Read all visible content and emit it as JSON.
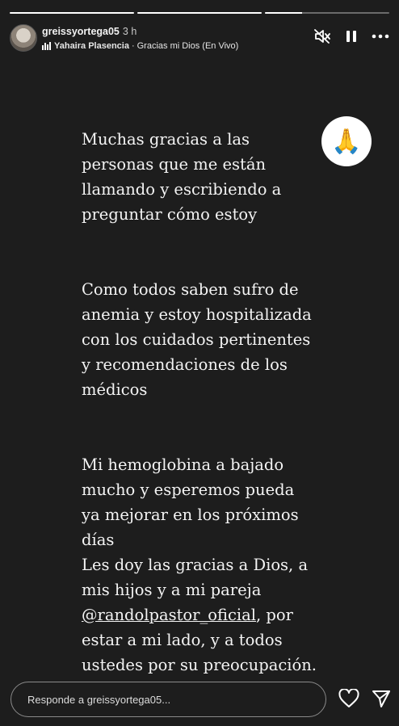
{
  "progress": [
    1,
    1,
    0.3
  ],
  "header": {
    "username": "greissyortega05",
    "time": "3 h",
    "music_artist": "Yahaira Plasencia",
    "music_separator": "·",
    "music_song": "Gracias mi Dios (En Vivo)"
  },
  "icons": {
    "mute": "speaker-muted-icon",
    "pause": "pause-icon",
    "more": "more-options-icon",
    "like": "heart-icon",
    "send": "send-icon",
    "music": "music-bars-icon"
  },
  "story": {
    "p1": "Muchas gracias a las\npersonas que me están\nllamando y escribiendo a\npreguntar cómo estoy",
    "p2": "Como todos saben sufro de\nanemia y estoy hospitalizada\ncon los cuidados pertinentes\ny recomendaciones  de los\nmédicos",
    "p3": "Mi hemoglobina a bajado\nmucho y esperemos pueda\nya mejorar en los próximos\ndías\nLes doy las gracias a Dios, a\nmis hijos y a mi pareja\n",
    "mention": "@randolpastor_oficial",
    "p3_tail": ", por\nestar a mi lado, y a todos\nustedes por su preocupación."
  },
  "sticker": {
    "emoji": "🙏"
  },
  "reply": {
    "placeholder": "Responde a greissyortega05..."
  }
}
